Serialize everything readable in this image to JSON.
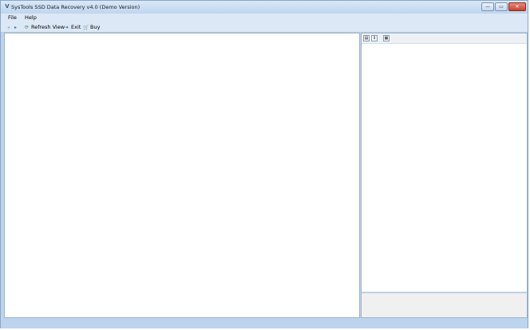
{
  "window": {
    "title": "SysTools SSD Data Recovery v4.0 (Demo Version)",
    "app_icon_glyph": "V",
    "buttons": {
      "minimize": "—",
      "maximize": "▭",
      "close": "✕"
    }
  },
  "menu": [
    {
      "label": "File"
    },
    {
      "label": "Help"
    }
  ],
  "toolbar": {
    "prev_icon": "◂",
    "next_icon": "▸",
    "refresh_label": "Refresh View",
    "exit_label": "Exit",
    "buy_label": "Buy"
  },
  "properties_toolbar": {
    "categorized_glyph": "▤",
    "alpha_glyph": "↕",
    "pages_glyph": "▦"
  },
  "colors": {
    "window_frame": "#bcd4ee",
    "pane_border": "#9fb4cd",
    "accent_blue": "#3a6fb3"
  }
}
